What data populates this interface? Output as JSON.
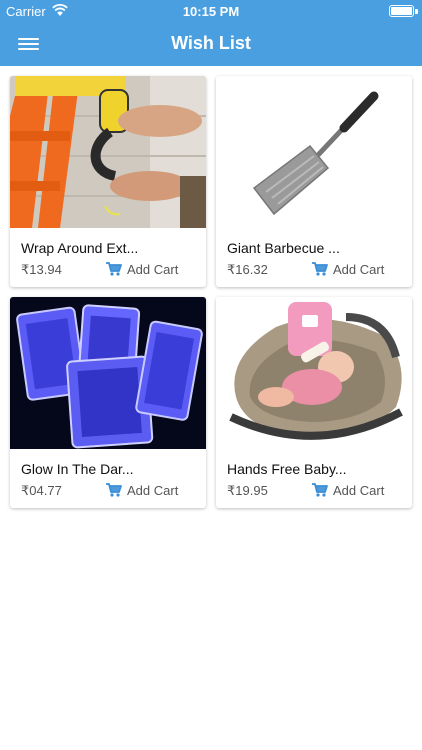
{
  "status_bar": {
    "carrier": "Carrier",
    "time": "10:15 PM"
  },
  "header": {
    "title": "Wish List",
    "menu_icon": "hamburger-menu-icon"
  },
  "products": [
    {
      "name": "Wrap Around Ext...",
      "price": "₹13.94",
      "add_label": "Add Cart",
      "image": "orange-ladder-with-handle"
    },
    {
      "name": "Giant Barbecue ...",
      "price": "₹16.32",
      "add_label": "Add Cart",
      "image": "metal-spatula"
    },
    {
      "name": "Glow In The Dar...",
      "price": "₹04.77",
      "add_label": "Add Cart",
      "image": "glowing-playing-cards"
    },
    {
      "name": "Hands Free Baby...",
      "price": "₹19.95",
      "add_label": "Add Cart",
      "image": "baby-in-car-seat-with-bottle-holder"
    }
  ],
  "colors": {
    "accent": "#4a9fe0",
    "cart_icon": "#3b8fd6"
  }
}
